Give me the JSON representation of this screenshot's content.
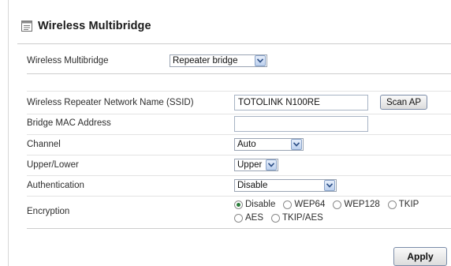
{
  "page": {
    "title": "Wireless Multibridge"
  },
  "mode": {
    "label": "Wireless Multibridge",
    "selected": "Repeater bridge"
  },
  "fields": {
    "ssid_label": "Wireless Repeater Network Name (SSID)",
    "ssid_value": "TOTOLINK N100RE",
    "scan_button": "Scan AP",
    "mac_label": "Bridge MAC Address",
    "mac_value": "",
    "channel_label": "Channel",
    "channel_value": "Auto",
    "upper_lower_label": "Upper/Lower",
    "upper_lower_value": "Upper",
    "auth_label": "Authentication",
    "auth_value": "Disable",
    "encryption_label": "Encryption",
    "encryption_options": [
      "Disable",
      "WEP64",
      "WEP128",
      "TKIP",
      "AES",
      "TKIP/AES"
    ],
    "encryption_selected": "Disable"
  },
  "actions": {
    "apply": "Apply"
  },
  "icons": {
    "page": "document-icon",
    "dropdown": "chevron-down-icon"
  }
}
